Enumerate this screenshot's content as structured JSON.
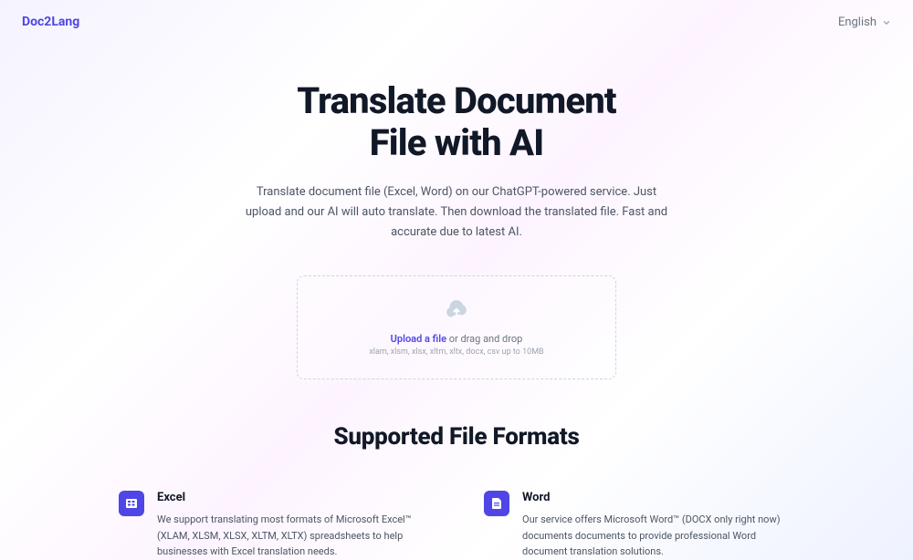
{
  "header": {
    "logo": "Doc2Lang",
    "language": "English"
  },
  "hero": {
    "title_line1": "Translate Document",
    "title_line2": "File with AI",
    "description": "Translate document file (Excel, Word) on our ChatGPT-powered service. Just upload and our AI will auto translate. Then download the translated file. Fast and accurate due to latest AI."
  },
  "upload": {
    "link_text": "Upload a file",
    "drag_text": " or drag and drop",
    "formats": "xlam, xlsm, xlsx, xltm, xltx, docx, csv up to 10MB"
  },
  "formats_section": {
    "title": "Supported File Formats",
    "items": [
      {
        "name": "Excel",
        "description": "We support translating most formats of Microsoft Excel™ (XLAM, XLSM, XLSX, XLTM, XLTX) spreadsheets to help businesses with Excel translation needs."
      },
      {
        "name": "Word",
        "description": "Our service offers Microsoft Word™ (DOCX only right now) documents documents to provide professional Word document translation solutions."
      }
    ]
  }
}
